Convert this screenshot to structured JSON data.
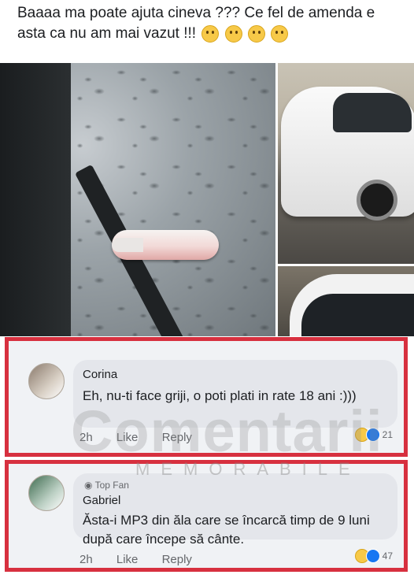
{
  "post": {
    "text": "Baaaa ma poate ajuta cineva ??? Ce fel de amenda e asta ca nu am mai vazut !!!",
    "emojis": [
      "thinking-face-icon",
      "flushed-face-icon",
      "dizzy-face-icon",
      "grinning-face-icon"
    ]
  },
  "comments": [
    {
      "author": "Corina",
      "text": "Eh, nu-ti face griji, o poti plati in rate 18 ani :)))",
      "time": "2h",
      "like_label": "Like",
      "reply_label": "Reply",
      "reaction_count": "21"
    },
    {
      "badge": "Top Fan",
      "author": "Gabriel",
      "text": "Ăsta-i MP3 din ăla care se încarcă timp de 9 luni după care începe să cânte.",
      "time": "2h",
      "like_label": "Like",
      "reply_label": "Reply",
      "reaction_count": "47"
    }
  ],
  "watermark": {
    "main": "Comentarii",
    "sub": "MEMORABILE"
  },
  "colors": {
    "highlight_border": "#d7303f",
    "like_blue": "#1877f2"
  }
}
